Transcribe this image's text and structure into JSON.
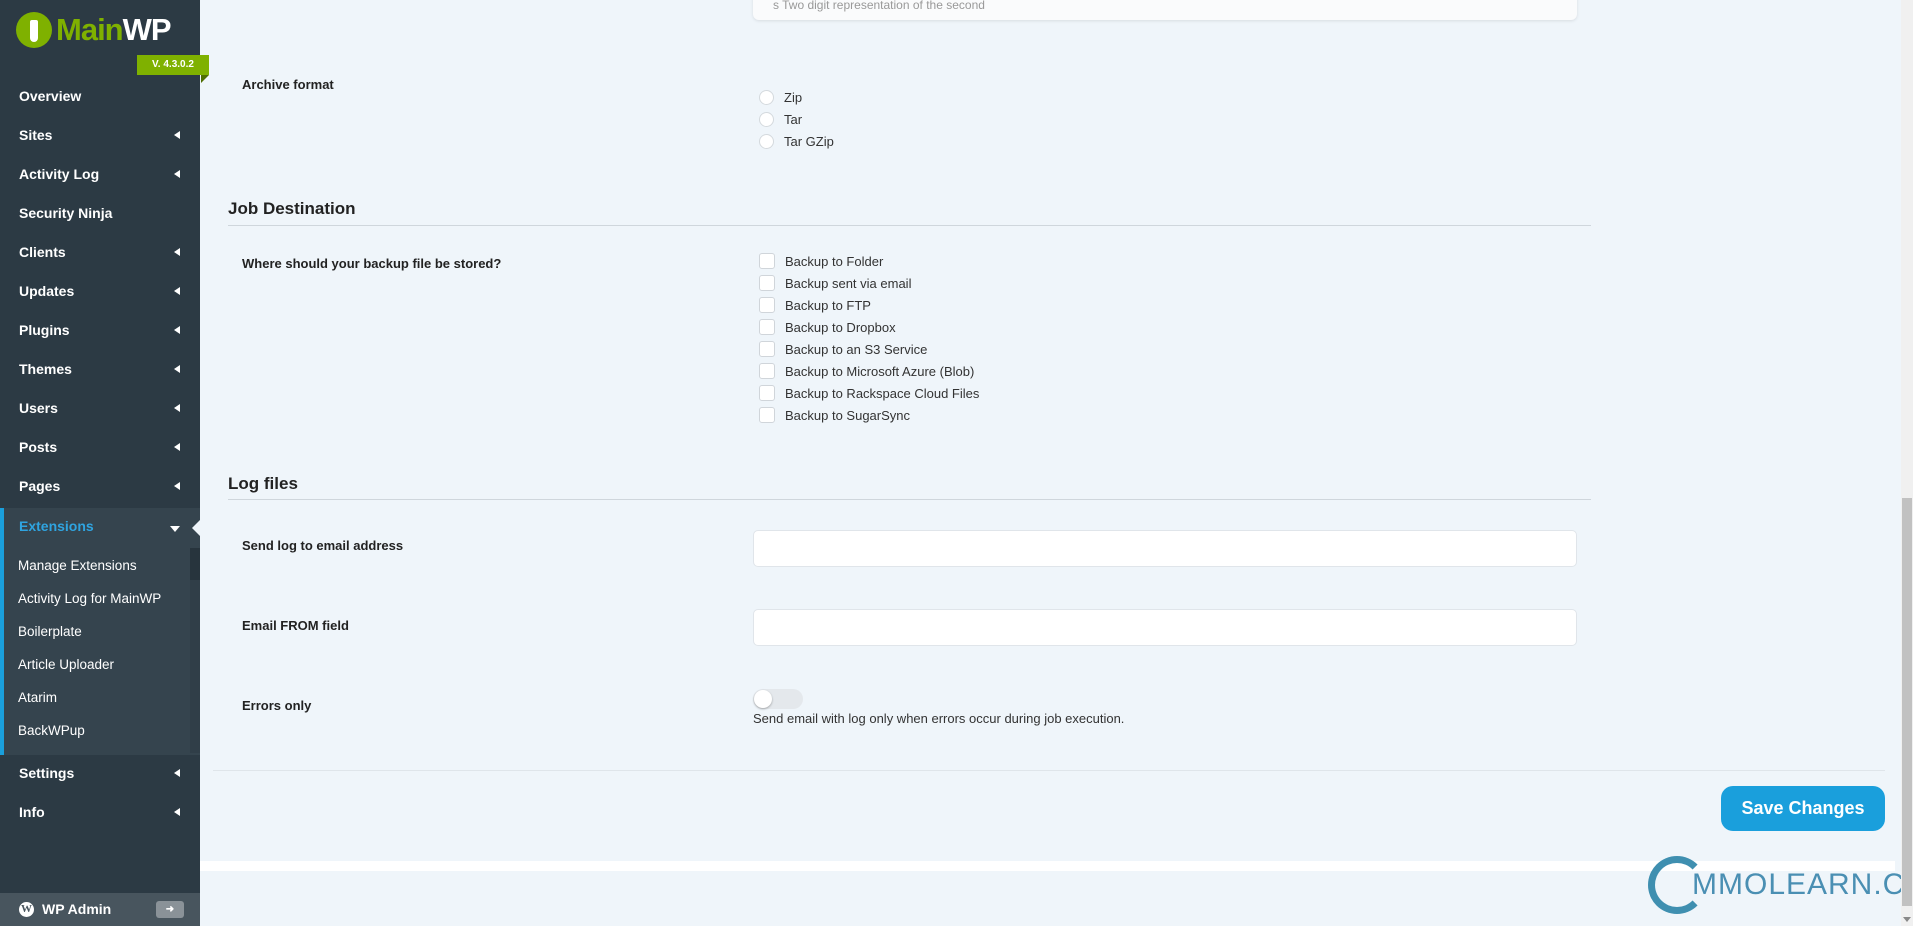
{
  "sidebar": {
    "logo": {
      "text_green": "Main",
      "text_white": "WP"
    },
    "version": "V. 4.3.0.2",
    "items": [
      {
        "label": "Overview",
        "has_arrow": false
      },
      {
        "label": "Sites",
        "has_arrow": true
      },
      {
        "label": "Activity Log",
        "has_arrow": true
      },
      {
        "label": "Security Ninja",
        "has_arrow": false
      },
      {
        "label": "Clients",
        "has_arrow": true
      },
      {
        "label": "Updates",
        "has_arrow": true
      },
      {
        "label": "Plugins",
        "has_arrow": true
      },
      {
        "label": "Themes",
        "has_arrow": true
      },
      {
        "label": "Users",
        "has_arrow": true
      },
      {
        "label": "Posts",
        "has_arrow": true
      },
      {
        "label": "Pages",
        "has_arrow": true
      }
    ],
    "extensions": {
      "label": "Extensions",
      "sub": [
        "Manage Extensions",
        "Activity Log for MainWP",
        "Boilerplate",
        "Article Uploader",
        "Atarim",
        "BackWPup"
      ]
    },
    "after": [
      {
        "label": "Settings"
      },
      {
        "label": "Info"
      }
    ],
    "wp_admin": "WP Admin",
    "accent": "#1a9fdc",
    "brand": "#7fb100"
  },
  "main": {
    "top_card_text": "s   Two digit representation of the second",
    "archive": {
      "label": "Archive format",
      "options": [
        "Zip",
        "Tar",
        "Tar GZip"
      ]
    },
    "job_destination": {
      "heading": "Job Destination",
      "question": "Where should your backup file be stored?",
      "options": [
        "Backup to Folder",
        "Backup sent via email",
        "Backup to FTP",
        "Backup to Dropbox",
        "Backup to an S3 Service",
        "Backup to Microsoft Azure (Blob)",
        "Backup to Rackspace Cloud Files",
        "Backup to SugarSync"
      ]
    },
    "log_files": {
      "heading": "Log files",
      "send_log_label": "Send log to email address",
      "send_log_value": "",
      "email_from_label": "Email FROM field",
      "email_from_value": "",
      "errors_only_label": "Errors only",
      "errors_only_on": false,
      "errors_only_help": "Send email with log only when errors occur during job execution."
    },
    "save_label": "Save Changes"
  },
  "watermark": "MMOLEARN.COM"
}
